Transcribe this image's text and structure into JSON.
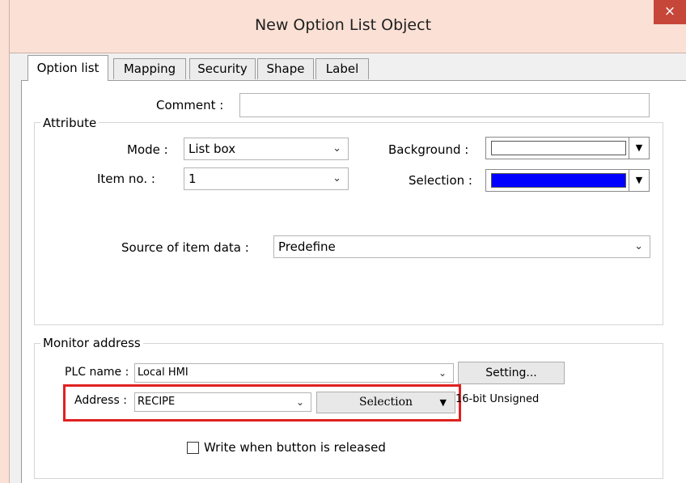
{
  "window": {
    "title": "New  Option List Object",
    "close_icon": "×"
  },
  "tabs": [
    {
      "label": "Option list",
      "active": true
    },
    {
      "label": "Mapping"
    },
    {
      "label": "Security"
    },
    {
      "label": "Shape"
    },
    {
      "label": "Label"
    }
  ],
  "comment": {
    "label": "Comment :",
    "value": ""
  },
  "attribute": {
    "title": "Attribute",
    "mode_label": "Mode :",
    "mode_value": "List box",
    "item_no_label": "Item no. :",
    "item_no_value": "1",
    "background_label": "Background :",
    "background_color": "#ffffff",
    "selection_label": "Selection :",
    "selection_color": "#0000ff",
    "source_label": "Source of item data :",
    "source_value": "Predefine"
  },
  "monitor": {
    "title": "Monitor address",
    "plc_label": "PLC name :",
    "plc_value": "Local HMI",
    "setting_button": "Setting...",
    "address_label": "Address :",
    "address_value": "RECIPE",
    "selection_button": "Selection",
    "type_text": "16-bit Unsigned",
    "write_checkbox_label": "Write when button is released",
    "write_checked": false
  },
  "colors": {
    "titlebar": "#fbe1d5",
    "close": "#c7463a",
    "highlight": "#e02020"
  }
}
